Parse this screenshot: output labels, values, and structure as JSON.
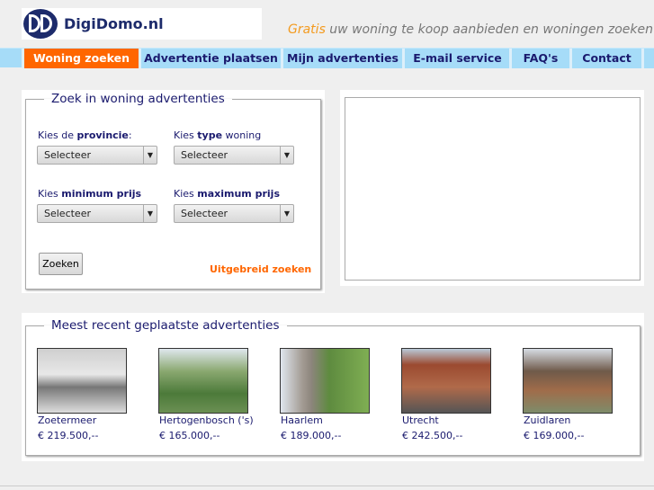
{
  "header": {
    "logo_text": "DigiDomo.nl",
    "tagline_highlight": "Gratis",
    "tagline_rest": " uw woning te koop aanbieden en woningen zoeken"
  },
  "nav": [
    {
      "label": "Woning zoeken",
      "active": true
    },
    {
      "label": "Advertentie plaatsen"
    },
    {
      "label": "Mijn advertenties"
    },
    {
      "label": "E-mail service"
    },
    {
      "label": "FAQ's"
    },
    {
      "label": "Contact"
    }
  ],
  "search": {
    "title": "Zoek in woning advertenties",
    "provincie": {
      "pre": "Kies de ",
      "bold": "provincie",
      "post": ":",
      "value": "Selecteer"
    },
    "type": {
      "pre": "Kies ",
      "bold": "type",
      "post": " woning",
      "value": "Selecteer"
    },
    "min": {
      "pre": "Kies ",
      "bold": "minimum prijs",
      "post": "",
      "value": "Selecteer"
    },
    "max": {
      "pre": "Kies ",
      "bold": "maximum prijs",
      "post": "",
      "value": "Selecteer"
    },
    "submit": "Zoeken",
    "advanced": "Uitgebreid zoeken"
  },
  "recent": {
    "title": "Meest recent geplaatste advertenties",
    "items": [
      {
        "city": "Zoetermeer",
        "price": "€ 219.500,--"
      },
      {
        "city": "Hertogenbosch ('s)",
        "price": "€ 165.000,--"
      },
      {
        "city": "Haarlem",
        "price": "€ 189.000,--"
      },
      {
        "city": "Utrecht",
        "price": "€ 242.500,--"
      },
      {
        "city": "Zuidlaren",
        "price": "€ 169.000,--"
      }
    ]
  },
  "colors": {
    "accent": "#ff6600",
    "nav": "#a6dcf8",
    "text": "#1a1a6e"
  }
}
